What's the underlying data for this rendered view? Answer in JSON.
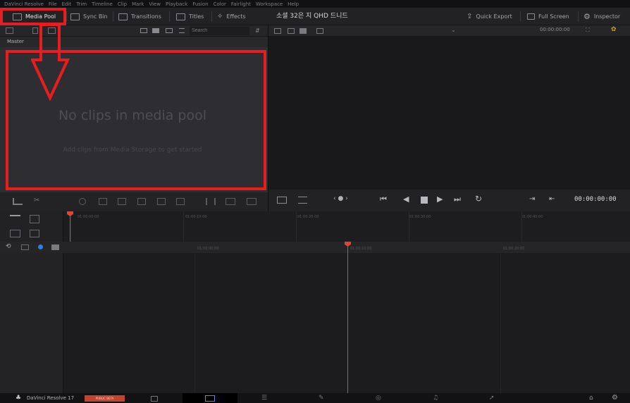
{
  "menu": [
    "DaVinci Resolve",
    "File",
    "Edit",
    "Trim",
    "Timeline",
    "Clip",
    "Mark",
    "View",
    "Playback",
    "Fusion",
    "Color",
    "Fairlight",
    "Workspace",
    "Help"
  ],
  "toolbar": {
    "media_pool": "Media Pool",
    "sync_bin": "Sync Bin",
    "transitions": "Transitions",
    "titles": "Titles",
    "effects": "Effects",
    "project_title": "소셜 32은 지 QHD 드니드",
    "quick_export": "Quick Export",
    "full_screen": "Full Screen",
    "inspector": "Inspector"
  },
  "media_pool": {
    "search_placeholder": "Search",
    "bin": "Master",
    "empty_title": "No clips in media pool",
    "empty_hint": "Add clips from Media Storage to get started"
  },
  "viewer": {
    "timecode_top": "00:00:00:00",
    "timecode": "00:00:00:00"
  },
  "timeline": {
    "ruler_labels": [
      "01:00:00:00",
      "01:00:10:00",
      "01:00:20:00",
      "01:00:30:00",
      "01:00:40:00"
    ],
    "track_labels": [
      "01:00:00:00",
      "01:00:10:00",
      "01:00:20:00"
    ]
  },
  "pagebar": {
    "app_name": "DaVinci Resolve 17",
    "badge": "PUBLIC BETA"
  },
  "colors": {
    "highlight": "#e81d20",
    "playhead": "#e34431",
    "badge": "#c2432f"
  },
  "icons": [
    "media-pool-icon",
    "sync-bin-icon",
    "transitions-icon",
    "titles-icon",
    "effects-icon",
    "quick-export-icon",
    "full-screen-icon",
    "inspector-icon"
  ]
}
